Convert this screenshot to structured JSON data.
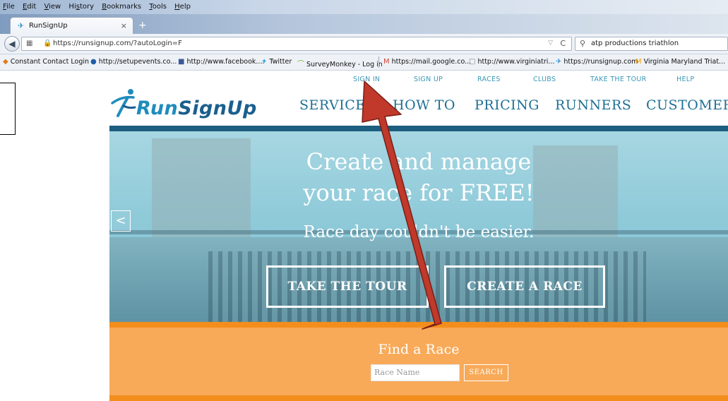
{
  "menubar": {
    "items": [
      "File",
      "Edit",
      "View",
      "History",
      "Bookmarks",
      "Tools",
      "Help"
    ],
    "underline": [
      "F",
      "E",
      "V",
      "s",
      "B",
      "T",
      "H"
    ]
  },
  "tab": {
    "title": "RunSignUp",
    "close": "×",
    "new_tab": "+"
  },
  "navbar": {
    "url": "https://runsignup.com/?autoLogin=F",
    "search_text": "atp productions triathlon",
    "reload": "C"
  },
  "bookmarks": [
    {
      "label": "Constant Contact Login",
      "icon": "constant-contact-icon",
      "color": "#e07a1f"
    },
    {
      "label": "http://setupevents.co...",
      "icon": "setup-events-icon",
      "color": "#1c5fa8"
    },
    {
      "label": "http://www.facebook....",
      "icon": "facebook-icon",
      "color": "#3b5998"
    },
    {
      "label": "Twitter",
      "icon": "twitter-icon",
      "color": "#2ea7e0"
    },
    {
      "label": "SurveyMonkey - Log in",
      "icon": "surveymonkey-icon",
      "color": "#6bb030"
    },
    {
      "label": "https://mail.google.co...",
      "icon": "gmail-icon",
      "color": "#d14836"
    },
    {
      "label": "http://www.virginiatri...",
      "icon": "blank-page-icon",
      "color": "#888888"
    },
    {
      "label": "https://runsignup.com",
      "icon": "runsignup-icon",
      "color": "#2c8fd1"
    },
    {
      "label": "Virginia Maryland Triat...",
      "icon": "vm-icon",
      "color": "#f0a010"
    }
  ],
  "site": {
    "top_links": [
      "SIGN IN",
      "SIGN UP",
      "RACES",
      "CLUBS",
      "TAKE THE TOUR",
      "HELP"
    ],
    "logo": {
      "part1": "Run",
      "part2": "SignUp"
    },
    "main_nav": [
      "SERVICES",
      "HOW TO",
      "PRICING",
      "RUNNERS",
      "CUSTOMER"
    ],
    "hero": {
      "line1": "Create and manage",
      "line2": "your race for FREE!",
      "subtitle": "Race day couldn't be easier.",
      "prev": "<",
      "btn_tour": "TAKE THE TOUR",
      "btn_create": "CREATE A RACE"
    },
    "find": {
      "title": "Find a Race",
      "input_placeholder": "Race Name",
      "search_button": "SEARCH"
    }
  },
  "colors": {
    "brand_blue": "#1f8cbd",
    "nav_dark": "#1b5e80",
    "orange": "#f8aa59",
    "orange_dark": "#f38d1c",
    "arrow": "#c0392b"
  }
}
